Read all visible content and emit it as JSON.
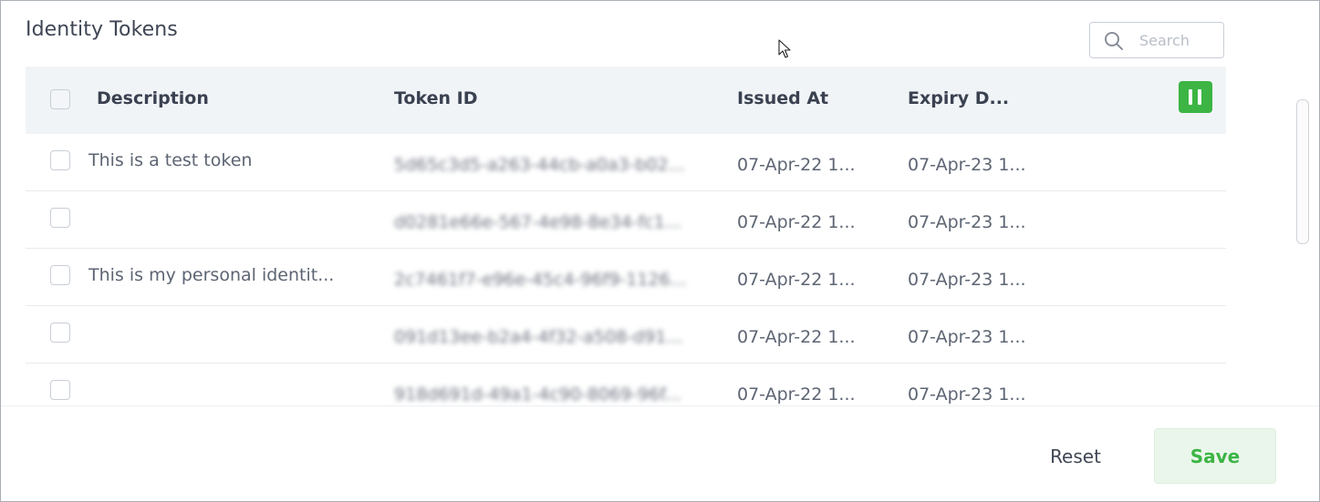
{
  "panel": {
    "title": "Identity Tokens"
  },
  "search": {
    "placeholder": "Search",
    "value": ""
  },
  "table": {
    "columns": [
      "Description",
      "Token ID",
      "Issued At",
      "Expiry D..."
    ],
    "rows": [
      {
        "description": "This is a test token",
        "token_id": "5d65c3d5-a263-44cb-a0a3-b02...",
        "issued_at": "07-Apr-22 1...",
        "expiry_date": "07-Apr-23 1..."
      },
      {
        "description": "",
        "token_id": "d0281e66e-567-4e98-8e34-fc1...",
        "issued_at": "07-Apr-22 1...",
        "expiry_date": "07-Apr-23 1..."
      },
      {
        "description": "This is my personal identit...",
        "token_id": "2c7461f7-e96e-45c4-96f9-1126...",
        "issued_at": "07-Apr-22 1...",
        "expiry_date": "07-Apr-23 1..."
      },
      {
        "description": "",
        "token_id": "091d13ee-b2a4-4f32-a508-d91...",
        "issued_at": "07-Apr-22 1...",
        "expiry_date": "07-Apr-23 1..."
      },
      {
        "description": "",
        "token_id": "918d691d-49a1-4c90-8069-96f...",
        "issued_at": "07-Apr-22 1...",
        "expiry_date": "07-Apr-23 1..."
      }
    ]
  },
  "footer": {
    "reset_label": "Reset",
    "save_label": "Save"
  },
  "colors": {
    "accent_green": "#3cb544",
    "save_bg": "#eaf6eb",
    "header_bg": "#f1f4f7",
    "text": "#3f4654"
  },
  "icons": {
    "search": "search-icon",
    "pause": "pause-icon",
    "cursor": "mouse-pointer-icon"
  }
}
